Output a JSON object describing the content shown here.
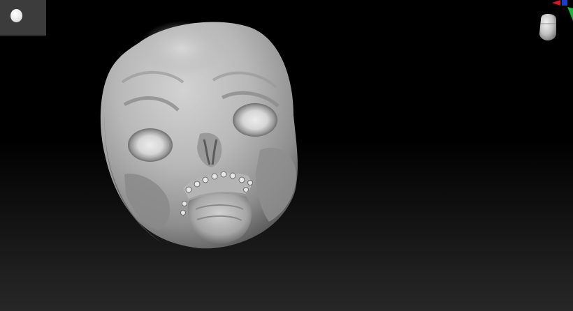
{
  "app": {
    "type": "3d-sculpting-viewport"
  },
  "navigator": {
    "icon": "model-thumbnail-icon"
  },
  "viewport": {
    "subject": "skull-sculpt",
    "background_top": "#000000",
    "background_bottom": "#272727",
    "model_color": "#b0b0b0"
  },
  "orientation_gizmo": {
    "icon": "axis-gizmo-icon",
    "axes": [
      {
        "axis": "x",
        "color": "#e0141e"
      },
      {
        "axis": "y",
        "color": "#1db43a"
      },
      {
        "axis": "z",
        "color": "#1e3ccc"
      }
    ]
  }
}
